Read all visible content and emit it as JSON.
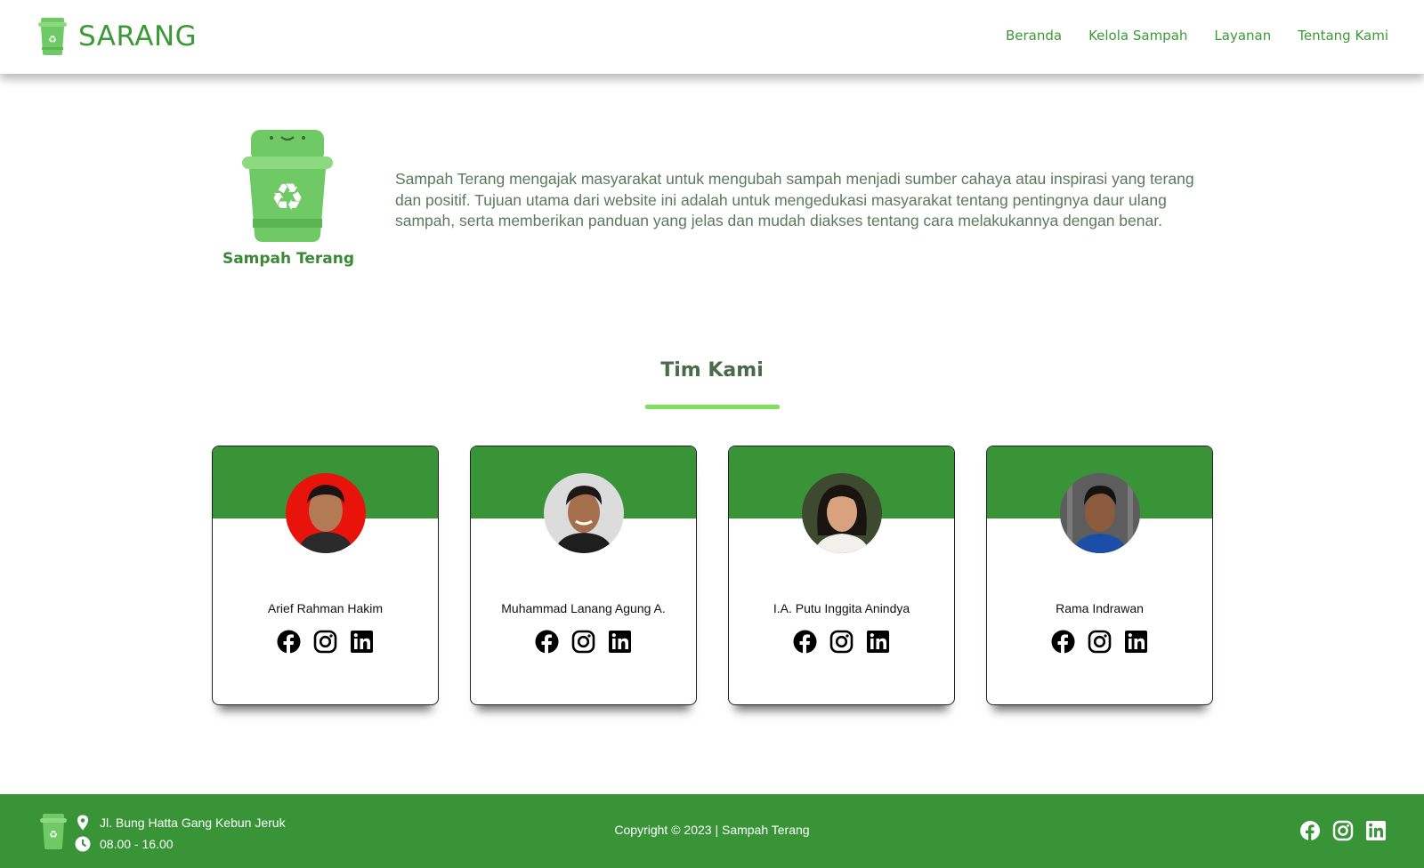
{
  "header": {
    "brand_name": "SARANG",
    "nav": [
      "Beranda",
      "Kelola Sampah",
      "Layanan",
      "Tentang Kami"
    ]
  },
  "about": {
    "caption": "Sampah Terang",
    "text": "Sampah Terang mengajak masyarakat untuk mengubah sampah menjadi sumber cahaya atau inspirasi yang terang dan positif. Tujuan utama dari website ini adalah untuk mengedukasi masyarakat tentang pentingnya daur ulang sampah, serta memberikan panduan yang jelas dan mudah diakses tentang cara melakukannya dengan benar."
  },
  "team": {
    "title": "Tim Kami",
    "members": [
      {
        "name": "Arief Rahman Hakim",
        "avatar_bg": "#e8130b"
      },
      {
        "name": "Muhammad Lanang Agung A.",
        "avatar_bg": "#dcdcdc"
      },
      {
        "name": "I.A. Putu Inggita Anindya",
        "avatar_bg": "#3d4a30"
      },
      {
        "name": "Rama Indrawan",
        "avatar_bg": "#6a6a6a"
      }
    ],
    "social_icons": [
      "facebook-icon",
      "instagram-icon",
      "linkedin-icon"
    ]
  },
  "footer": {
    "address": "Jl. Bung Hatta Gang Kebun Jeruk",
    "hours": "08.00 - 16.00",
    "copyright": "Copyright © 2023 | Sampah Terang"
  },
  "colors": {
    "brand_green": "#3a9a35",
    "band_green": "#399437",
    "accent_lime": "#7ee05a"
  }
}
